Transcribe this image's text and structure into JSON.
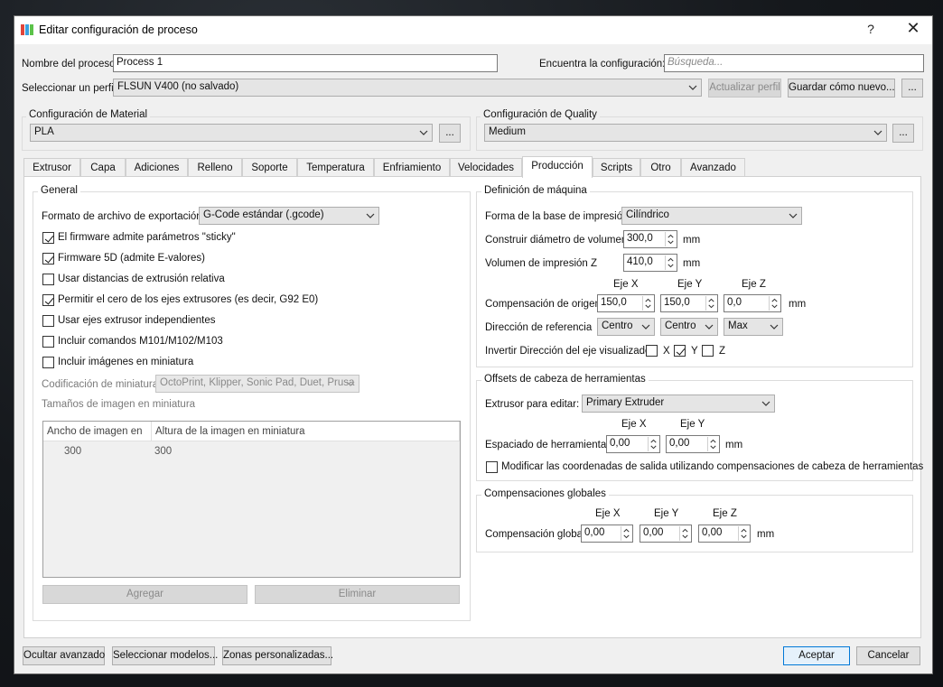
{
  "window": {
    "title": "Editar configuración de proceso",
    "help": "?",
    "close": "✕"
  },
  "header": {
    "process_name_label": "Nombre del proceso",
    "process_name_value": "Process 1",
    "find_config_label": "Encuentra la configuración:",
    "find_config_placeholder": "Búsqueda...",
    "select_profile_label": "Seleccionar un perfil",
    "profile_value": "FLSUN V400 (no salvado)",
    "update_profile": "Actualizar perfil",
    "save_as_new": "Guardar cómo nuevo...",
    "more": "..."
  },
  "material": {
    "title": "Configuración de Material",
    "value": "PLA",
    "more": "..."
  },
  "quality": {
    "title": "Configuración de Quality",
    "value": "Medium",
    "more": "..."
  },
  "tabs": [
    "Extrusor",
    "Capa",
    "Adiciones",
    "Relleno",
    "Soporte",
    "Temperatura",
    "Enfriamiento",
    "Velocidades",
    "Producción",
    "Scripts",
    "Otro",
    "Avanzado"
  ],
  "active_tab": "Producción",
  "general": {
    "title": "General",
    "export_format_label": "Formato de archivo de exportación",
    "export_format_value": "G-Code estándar (.gcode)",
    "checkboxes": [
      {
        "label": "El firmware admite parámetros \"sticky\"",
        "checked": true
      },
      {
        "label": "Firmware 5D (admite E-valores)",
        "checked": true
      },
      {
        "label": "Usar distancias de extrusión relativa",
        "checked": false
      },
      {
        "label": "Permitir el cero de los ejes extrusores (es decir, G92 E0)",
        "checked": true
      },
      {
        "label": "Usar ejes extrusor independientes",
        "checked": false
      },
      {
        "label": "Incluir comandos M101/M102/M103",
        "checked": false
      },
      {
        "label": "Incluir imágenes en miniatura",
        "checked": false
      }
    ],
    "thumb_encoding_label": "Codificación de miniatura",
    "thumb_encoding_value": "OctoPrint, Klipper, Sonic Pad, Duet, Prusa",
    "thumb_sizes_label": "Tamaños de imagen en miniatura",
    "table": {
      "headers": [
        "Ancho de imagen en",
        "Altura de la imagen en miniatura"
      ],
      "rows": [
        [
          "300",
          "300"
        ]
      ]
    },
    "add": "Agregar",
    "remove": "Eliminar"
  },
  "machine": {
    "title": "Definición de máquina",
    "bed_shape_label": "Forma de la base de impresión",
    "bed_shape_value": "Cilíndrico",
    "diameter_label": "Construir diámetro de volumen",
    "diameter_value": "300,0",
    "z_label": "Volumen de impresión Z",
    "z_value": "410,0",
    "unit": "mm",
    "axis_x": "Eje X",
    "axis_y": "Eje Y",
    "axis_z": "Eje Z",
    "origin_label": "Compensación de origen",
    "origin_x": "150,0",
    "origin_y": "150,0",
    "origin_z": "0,0",
    "ref_label": "Dirección de referencia",
    "ref_x": "Centro",
    "ref_y": "Centro",
    "ref_z": "Max",
    "invert_label": "Invertir Dirección del eje visualizado",
    "invert_x": "X",
    "invert_y": "Y",
    "invert_z": "Z",
    "invert_x_checked": false,
    "invert_y_checked": true,
    "invert_z_checked": false
  },
  "toolhead": {
    "title": "Offsets de cabeza de herramientas",
    "extruder_label": "Extrusor para editar:",
    "extruder_value": "Primary Extruder",
    "axis_x": "Eje X",
    "axis_y": "Eje Y",
    "spacing_label": "Espaciado de herramientas",
    "spacing_x": "0,00",
    "spacing_y": "0,00",
    "unit": "mm",
    "modify_label": "Modificar las coordenadas de salida utilizando compensaciones de cabeza de herramientas"
  },
  "global": {
    "title": "Compensaciones globales",
    "axis_x": "Eje X",
    "axis_y": "Eje Y",
    "axis_z": "Eje Z",
    "label": "Compensación global",
    "x": "0,00",
    "y": "0,00",
    "z": "0,00",
    "unit": "mm"
  },
  "footer": {
    "hide_advanced": "Ocultar avanzado",
    "select_models": "Seleccionar modelos...",
    "custom_zones": "Zonas personalizadas...",
    "accept": "Aceptar",
    "cancel": "Cancelar"
  }
}
